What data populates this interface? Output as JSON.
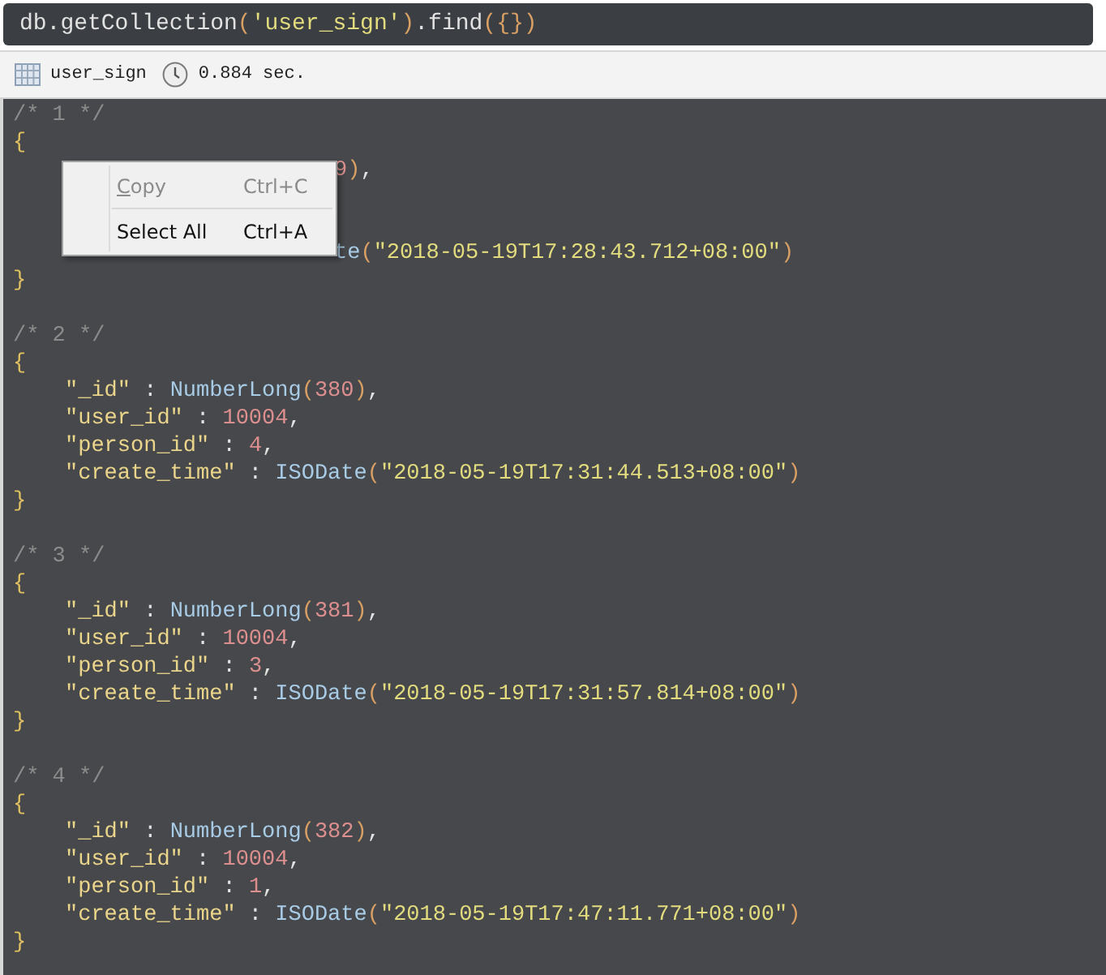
{
  "query": {
    "tokens": [
      {
        "kind": "plain",
        "text": "db.getCollection"
      },
      {
        "kind": "paren",
        "text": "("
      },
      {
        "kind": "str",
        "text": "'user_sign'"
      },
      {
        "kind": "paren",
        "text": ")"
      },
      {
        "kind": "plain",
        "text": ".find"
      },
      {
        "kind": "paren",
        "text": "({})"
      }
    ]
  },
  "status": {
    "collection": "user_sign",
    "time": "0.884 sec."
  },
  "records": [
    {
      "comment": "/* 1 */",
      "open": "{",
      "close": "}",
      "lines": [
        {
          "kind": "clipped",
          "tokens": [
            {
              "kind": "num",
              "text": "9"
            },
            {
              "kind": "paren",
              "text": ")"
            },
            {
              "kind": "plain",
              "text": ","
            }
          ]
        },
        {
          "kind": "covered"
        },
        {
          "kind": "covered"
        },
        {
          "kind": "clipped",
          "tokens": [
            {
              "kind": "fn",
              "text": "te"
            },
            {
              "kind": "paren",
              "text": "("
            },
            {
              "kind": "str",
              "text": "\"2018-05-19T17:28:43.712+08:00\""
            },
            {
              "kind": "paren",
              "text": ")"
            }
          ]
        }
      ]
    },
    {
      "comment": "/* 2 */",
      "open": "{",
      "close": "}",
      "lines": [
        {
          "kind": "full",
          "tokens": [
            {
              "kind": "key",
              "text": "\"_id\""
            },
            {
              "kind": "plain",
              "text": " : "
            },
            {
              "kind": "fn",
              "text": "NumberLong"
            },
            {
              "kind": "paren",
              "text": "("
            },
            {
              "kind": "num",
              "text": "380"
            },
            {
              "kind": "paren",
              "text": ")"
            },
            {
              "kind": "plain",
              "text": ","
            }
          ]
        },
        {
          "kind": "full",
          "tokens": [
            {
              "kind": "key",
              "text": "\"user_id\""
            },
            {
              "kind": "plain",
              "text": " : "
            },
            {
              "kind": "num",
              "text": "10004"
            },
            {
              "kind": "plain",
              "text": ","
            }
          ]
        },
        {
          "kind": "full",
          "tokens": [
            {
              "kind": "key",
              "text": "\"person_id\""
            },
            {
              "kind": "plain",
              "text": " : "
            },
            {
              "kind": "num",
              "text": "4"
            },
            {
              "kind": "plain",
              "text": ","
            }
          ]
        },
        {
          "kind": "full",
          "tokens": [
            {
              "kind": "key",
              "text": "\"create_time\""
            },
            {
              "kind": "plain",
              "text": " : "
            },
            {
              "kind": "fn",
              "text": "ISODate"
            },
            {
              "kind": "paren",
              "text": "("
            },
            {
              "kind": "str",
              "text": "\"2018-05-19T17:31:44.513+08:00\""
            },
            {
              "kind": "paren",
              "text": ")"
            }
          ]
        }
      ]
    },
    {
      "comment": "/* 3 */",
      "open": "{",
      "close": "}",
      "lines": [
        {
          "kind": "full",
          "tokens": [
            {
              "kind": "key",
              "text": "\"_id\""
            },
            {
              "kind": "plain",
              "text": " : "
            },
            {
              "kind": "fn",
              "text": "NumberLong"
            },
            {
              "kind": "paren",
              "text": "("
            },
            {
              "kind": "num",
              "text": "381"
            },
            {
              "kind": "paren",
              "text": ")"
            },
            {
              "kind": "plain",
              "text": ","
            }
          ]
        },
        {
          "kind": "full",
          "tokens": [
            {
              "kind": "key",
              "text": "\"user_id\""
            },
            {
              "kind": "plain",
              "text": " : "
            },
            {
              "kind": "num",
              "text": "10004"
            },
            {
              "kind": "plain",
              "text": ","
            }
          ]
        },
        {
          "kind": "full",
          "tokens": [
            {
              "kind": "key",
              "text": "\"person_id\""
            },
            {
              "kind": "plain",
              "text": " : "
            },
            {
              "kind": "num",
              "text": "3"
            },
            {
              "kind": "plain",
              "text": ","
            }
          ]
        },
        {
          "kind": "full",
          "tokens": [
            {
              "kind": "key",
              "text": "\"create_time\""
            },
            {
              "kind": "plain",
              "text": " : "
            },
            {
              "kind": "fn",
              "text": "ISODate"
            },
            {
              "kind": "paren",
              "text": "("
            },
            {
              "kind": "str",
              "text": "\"2018-05-19T17:31:57.814+08:00\""
            },
            {
              "kind": "paren",
              "text": ")"
            }
          ]
        }
      ]
    },
    {
      "comment": "/* 4 */",
      "open": "{",
      "close": "}",
      "lines": [
        {
          "kind": "full",
          "tokens": [
            {
              "kind": "key",
              "text": "\"_id\""
            },
            {
              "kind": "plain",
              "text": " : "
            },
            {
              "kind": "fn",
              "text": "NumberLong"
            },
            {
              "kind": "paren",
              "text": "("
            },
            {
              "kind": "num",
              "text": "382"
            },
            {
              "kind": "paren",
              "text": ")"
            },
            {
              "kind": "plain",
              "text": ","
            }
          ]
        },
        {
          "kind": "full",
          "tokens": [
            {
              "kind": "key",
              "text": "\"user_id\""
            },
            {
              "kind": "plain",
              "text": " : "
            },
            {
              "kind": "num",
              "text": "10004"
            },
            {
              "kind": "plain",
              "text": ","
            }
          ]
        },
        {
          "kind": "full",
          "tokens": [
            {
              "kind": "key",
              "text": "\"person_id\""
            },
            {
              "kind": "plain",
              "text": " : "
            },
            {
              "kind": "num",
              "text": "1"
            },
            {
              "kind": "plain",
              "text": ","
            }
          ]
        },
        {
          "kind": "full",
          "tokens": [
            {
              "kind": "key",
              "text": "\"create_time\""
            },
            {
              "kind": "plain",
              "text": " : "
            },
            {
              "kind": "fn",
              "text": "ISODate"
            },
            {
              "kind": "paren",
              "text": "("
            },
            {
              "kind": "str",
              "text": "\"2018-05-19T17:47:11.771+08:00\""
            },
            {
              "kind": "paren",
              "text": ")"
            }
          ]
        }
      ]
    }
  ],
  "context_menu": {
    "items": [
      {
        "label": "Copy",
        "shortcut": "Ctrl+C",
        "disabled": true,
        "mnemonic": true
      },
      {
        "label": "Select All",
        "shortcut": "Ctrl+A",
        "disabled": false,
        "mnemonic": false
      }
    ]
  }
}
